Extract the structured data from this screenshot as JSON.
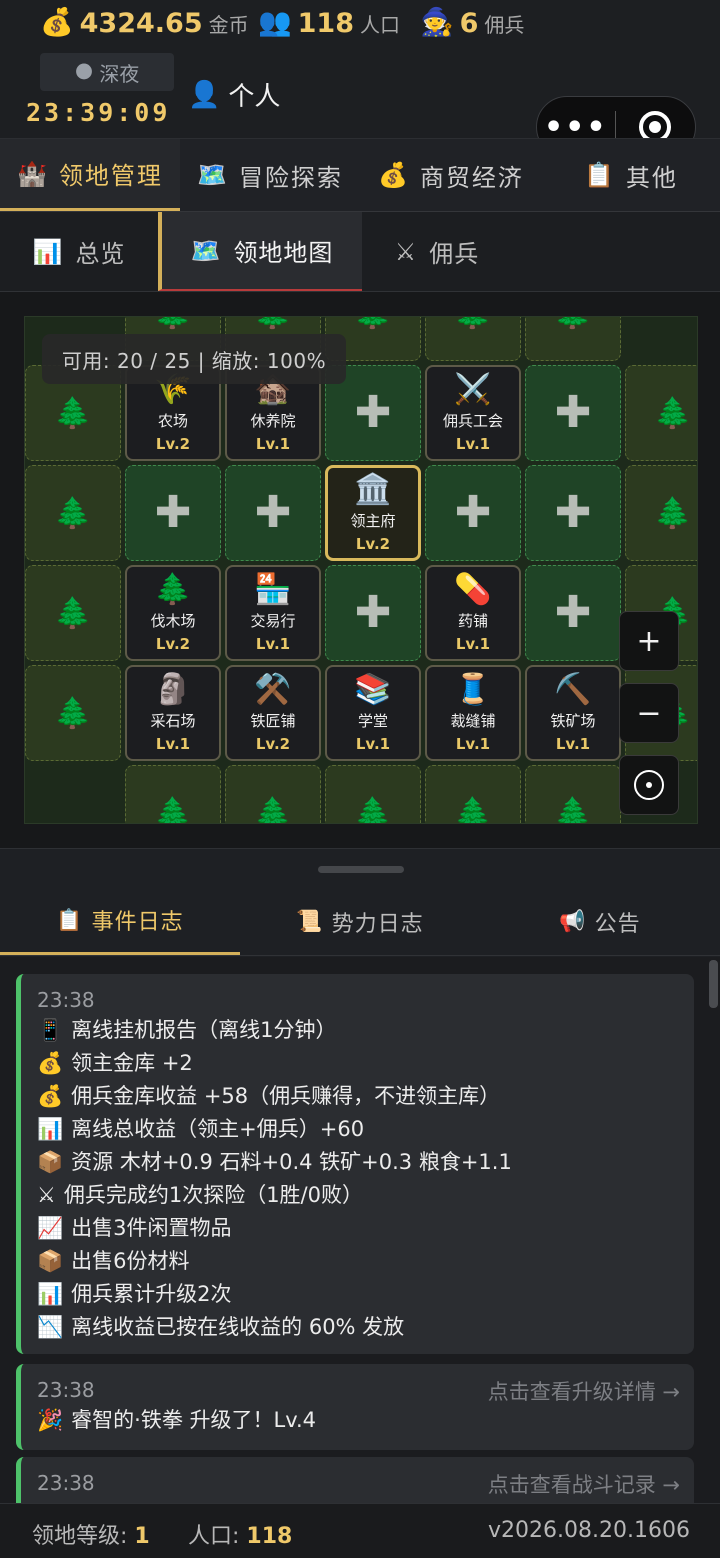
{
  "status": {
    "gold": {
      "icon": "money-bag-icon",
      "value": "4324.65",
      "unit": "金币"
    },
    "population": {
      "icon": "people-icon",
      "value": "118",
      "unit": "人口"
    },
    "mercenaries": {
      "icon": "mage-icon",
      "value": "6",
      "unit": "佣兵"
    },
    "time_period": "深夜",
    "clock": "23:39:09",
    "personal_label": "个人"
  },
  "main_tabs": [
    {
      "icon": "castle-icon",
      "label": "领地管理",
      "active": true
    },
    {
      "icon": "map-icon",
      "label": "冒险探索",
      "active": false
    },
    {
      "icon": "money-bag-icon",
      "label": "商贸经济",
      "active": false
    },
    {
      "icon": "clipboard-icon",
      "label": "其他",
      "active": false
    }
  ],
  "sub_tabs": [
    {
      "icon": "bar-chart-icon",
      "label": "总览",
      "active": false
    },
    {
      "icon": "map-icon",
      "label": "领地地图",
      "active": true
    },
    {
      "icon": "swords-icon",
      "label": "佣兵",
      "active": false
    }
  ],
  "map": {
    "info": "可用: 20 / 25 | 缩放: 100%",
    "zoom_in": "+",
    "zoom_out": "−",
    "buildings": {
      "farm": {
        "name": "农场",
        "level": "Lv.2",
        "icon": "🌾"
      },
      "sanatorium": {
        "name": "休养院",
        "level": "Lv.1",
        "icon": "🏚️"
      },
      "guild": {
        "name": "佣兵工会",
        "level": "Lv.1",
        "icon": "⚔️"
      },
      "lord_manor": {
        "name": "领主府",
        "level": "Lv.2",
        "icon": "🏛️"
      },
      "lumber": {
        "name": "伐木场",
        "level": "Lv.2",
        "icon": "🌲"
      },
      "exchange": {
        "name": "交易行",
        "level": "Lv.1",
        "icon": "🏪"
      },
      "pharmacy": {
        "name": "药铺",
        "level": "Lv.1",
        "icon": "💊"
      },
      "quarry": {
        "name": "采石场",
        "level": "Lv.1",
        "icon": "🗿"
      },
      "smithy": {
        "name": "铁匠铺",
        "level": "Lv.2",
        "icon": "⚒️"
      },
      "school": {
        "name": "学堂",
        "level": "Lv.1",
        "icon": "📚"
      },
      "tailor": {
        "name": "裁缝铺",
        "level": "Lv.1",
        "icon": "🧵"
      },
      "iron_mine": {
        "name": "铁矿场",
        "level": "Lv.1",
        "icon": "⛏️"
      }
    }
  },
  "log_tabs": [
    {
      "icon": "clipboard-icon",
      "label": "事件日志",
      "active": true
    },
    {
      "icon": "scroll-icon",
      "label": "势力日志",
      "active": false
    },
    {
      "icon": "megaphone-icon",
      "label": "公告",
      "active": false
    }
  ],
  "logs": [
    {
      "time": "23:38",
      "lines": [
        {
          "icon": "📱",
          "text": "离线挂机报告（离线1分钟）"
        },
        {
          "icon": "💰",
          "text": "领主金库 +2"
        },
        {
          "icon": "💰",
          "text": "佣兵金库收益 +58（佣兵赚得，不进领主库）"
        },
        {
          "icon": "📊",
          "text": "离线总收益（领主+佣兵）+60"
        },
        {
          "icon": "📦",
          "text": "资源 木材+0.9 石料+0.4 铁矿+0.3 粮食+1.1"
        },
        {
          "icon": "⚔",
          "text": "佣兵完成约1次探险（1胜/0败）"
        },
        {
          "icon": "📈",
          "text": "出售3件闲置物品"
        },
        {
          "icon": "📦",
          "text": "出售6份材料"
        },
        {
          "icon": "📊",
          "text": "佣兵累计升级2次"
        },
        {
          "icon": "📉",
          "text": "离线收益已按在线收益的 60% 发放"
        }
      ]
    },
    {
      "time": "23:38",
      "link": "点击查看升级详情 →",
      "lines": [
        {
          "icon": "🎉",
          "text": "睿智的·铁拳 升级了！Lv.4"
        }
      ]
    },
    {
      "time": "23:38",
      "link": "点击查看战斗记录 →",
      "lines": []
    }
  ],
  "footer": {
    "territory_level_label": "领地等级:",
    "territory_level": "1",
    "population_label": "人口:",
    "population": "118",
    "version": "v2026.08.20.1606"
  }
}
